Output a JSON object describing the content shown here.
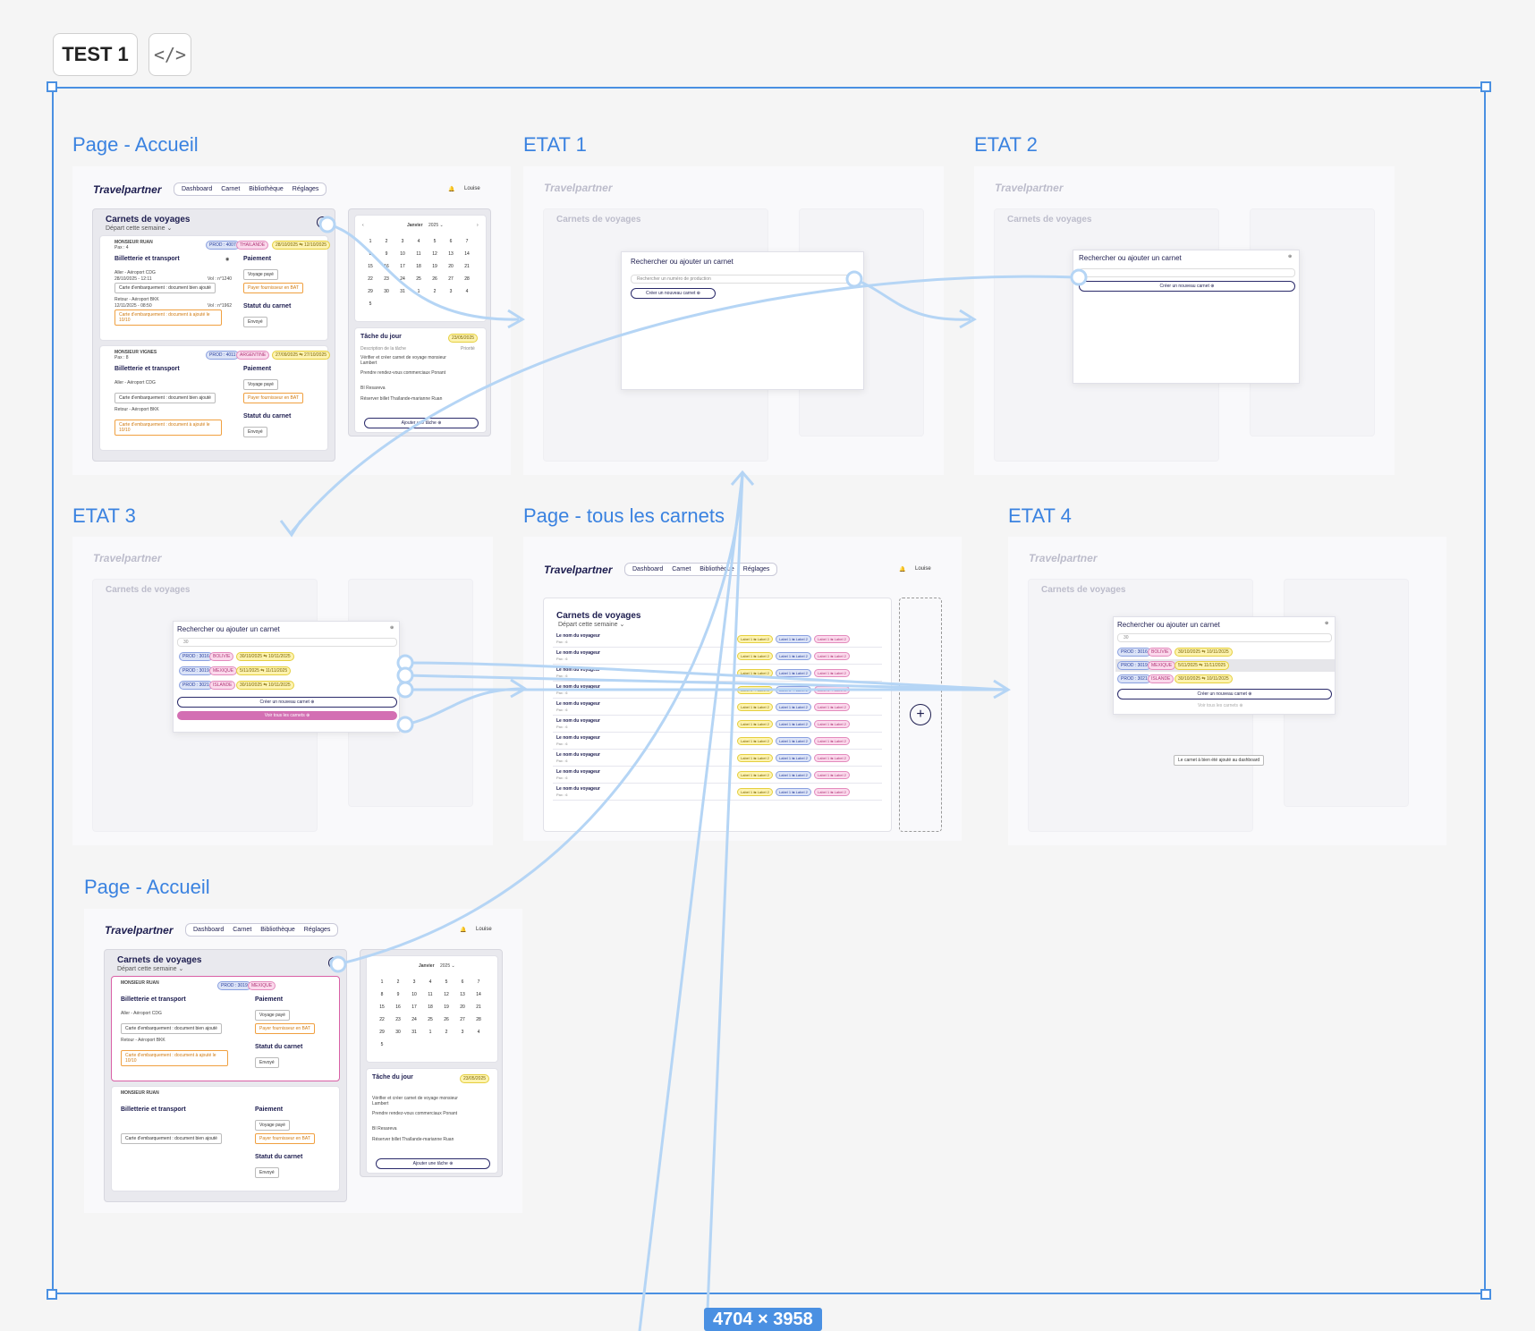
{
  "toolbar": {
    "test_label": "TEST 1",
    "code_icon": "</>"
  },
  "size_badge": "4704 × 3958",
  "frames": {
    "accueil_1": "Page - Accueil",
    "etat1": "ETAT 1",
    "etat2": "ETAT 2",
    "etat3": "ETAT 3",
    "tous_carnets": "Page - tous les carnets",
    "etat4": "ETAT 4",
    "accueil_2": "Page - Accueil"
  },
  "app": {
    "logo": "Travelpartner",
    "nav": [
      "Dashboard",
      "Carnet",
      "Bibliothèque",
      "Réglages"
    ],
    "user": "Louise",
    "carnets_title": "Carnets de voyages",
    "carnets_sub": "Départ cette semaine ⌄",
    "card1": {
      "client": "MONSIEUR RUAN",
      "pax": "Pax : 4",
      "prod": "PROD : 4007",
      "dest": "THAILANDE",
      "dates": "28/10/2025 ⇆ 12/10/2025",
      "billetterie": "Billetterie et transport",
      "paiement": "Paiement",
      "aller": "Aller - Aéroport CDG",
      "aller_date": "28/10/2025 - 12:11",
      "vol": "Vol : n°1240",
      "carte": "Carte d'embarquement : document bien ajouté",
      "retour": "Retour - Aéroport BKK",
      "retour_date": "12/11/2025 - 08:50",
      "vol2": "Vol : n°1962",
      "carte2": "Carte d'embarquement : document à ajouté le 10/10",
      "voyage_paye": "Voyage payé",
      "payer": "Payer fournisseur en BAT",
      "statut": "Statut du carnet",
      "envoye": "Envoyé"
    },
    "card2": {
      "client": "MONSIEUR VIGNES",
      "pax": "Pax : 8",
      "prod": "PROD : 4011",
      "dest": "ARGENTINE",
      "dates": "27/09/2025 ⇆ 27/10/2025"
    },
    "calendar": {
      "month": "Janvier",
      "year": "2025 ⌄",
      "days": [
        "1",
        "2",
        "3",
        "4",
        "5",
        "6",
        "7",
        "8",
        "9",
        "10",
        "11",
        "12",
        "13",
        "14",
        "15",
        "16",
        "17",
        "18",
        "19",
        "20",
        "21",
        "22",
        "23",
        "24",
        "25",
        "26",
        "27",
        "28",
        "29",
        "30",
        "31",
        "1",
        "2",
        "3",
        "4",
        "5"
      ]
    },
    "tasks": {
      "title": "Tâche du jour",
      "date": "23/05/2025",
      "desc_label": "Description de la tâche",
      "prio_label": "Priorité",
      "items": [
        "Vérifier et créer carnet de voyage monsieur Lambert",
        "Prendre rendez-vous commerciaux Ponant",
        "BI Resareva",
        "Réserver billet Thaïlande-marianne Ruan"
      ],
      "add": "Ajouter une tâche ⊕"
    }
  },
  "popup": {
    "title": "Rechercher ou ajouter un carnet",
    "placeholder": "Rechercher un numéro de production",
    "create": "Créer un nouveau carnet ⊕",
    "query": "30",
    "results": [
      {
        "prod": "PROD : 3016",
        "dest": "BOLIVIE",
        "dates": "30/10/2025 ⇆ 10/11/2025"
      },
      {
        "prod": "PROD : 3019",
        "dest": "MEXIQUE",
        "dates": "5/11/2025 ⇆ 11/11/2025"
      },
      {
        "prod": "PROD : 3021",
        "dest": "ISLANDE",
        "dates": "30/10/2025 ⇆ 10/11/2025"
      }
    ],
    "see_all": "Voir tous les carnets ⊕",
    "toast": "Le carnet à bien été ajouté au dashboard"
  },
  "list": {
    "rows": [
      "Le nom du voyageur",
      "Le nom du voyageur",
      "Le nom du voyageur",
      "Le nom du voyageur",
      "Le nom du voyageur",
      "Le nom du voyageur",
      "Le nom du voyageur",
      "Le nom du voyageur",
      "Le nom du voyageur",
      "Le nom du voyageur"
    ],
    "pax": "Pax : 6",
    "labels": [
      "Label 1 ⇆ Label 2",
      "Label 1 ⇆ Label 2",
      "Label 1 ⇆ Label 2"
    ]
  },
  "colors": {
    "accent": "#4a90e2",
    "arrow": "#b5d5f5",
    "navy": "#1d1d4f",
    "pink": "#d36fb3"
  }
}
